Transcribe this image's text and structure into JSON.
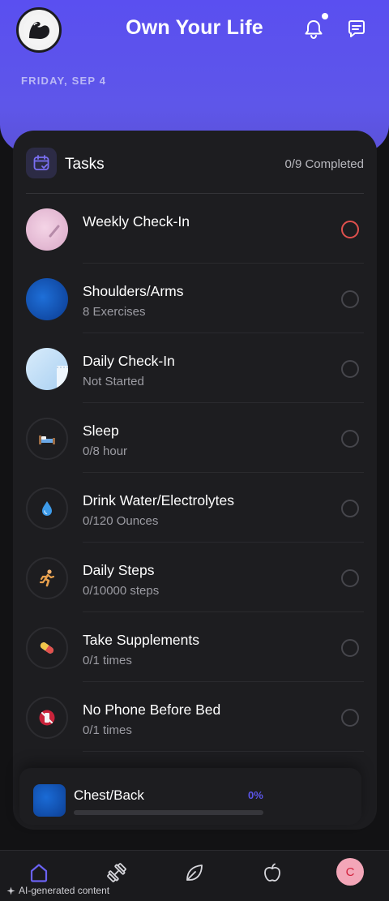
{
  "header": {
    "title": "Own Your Life",
    "date": "FRIDAY, SEP 4",
    "notification_dot": true
  },
  "tasks_card": {
    "title": "Tasks",
    "completed": "0/9 Completed",
    "items": [
      {
        "name": "Weekly Check-In",
        "sub": "",
        "icon": "weekly-checkin-photo",
        "check_color": "#e0504d"
      },
      {
        "name": "Shoulders/Arms",
        "sub": "8 Exercises",
        "icon": "workout-photo",
        "check_color": "#46464c"
      },
      {
        "name": "Daily Check-In",
        "sub": "Not Started",
        "icon": "daily-checkin-photo",
        "check_color": "#46464c"
      },
      {
        "name": "Sleep",
        "sub": "0/8 hour",
        "icon": "bed-icon",
        "check_color": "#46464c"
      },
      {
        "name": "Drink Water/Electrolytes",
        "sub": "0/120 Ounces",
        "icon": "water-drop-icon",
        "check_color": "#46464c"
      },
      {
        "name": "Daily Steps",
        "sub": "0/10000 steps",
        "icon": "running-person-icon",
        "check_color": "#46464c"
      },
      {
        "name": "Take Supplements",
        "sub": "0/1 times",
        "icon": "pill-icon",
        "check_color": "#46464c"
      },
      {
        "name": "No Phone Before Bed",
        "sub": "0/1 times",
        "icon": "no-phone-icon",
        "check_color": "#46464c"
      }
    ]
  },
  "now_playing": {
    "title": "Chest/Back",
    "percent": "0%",
    "progress": 0
  },
  "bottom_nav": {
    "items": [
      "home",
      "workouts",
      "habits",
      "nutrition",
      "profile"
    ],
    "profile_initial": "C"
  },
  "footer": {
    "ai_note": "AI-generated content"
  },
  "colors": {
    "accent": "#5b55e8",
    "header_gradient_top": "#5a4ff0",
    "background": "#121214",
    "card": "#1d1d20"
  }
}
